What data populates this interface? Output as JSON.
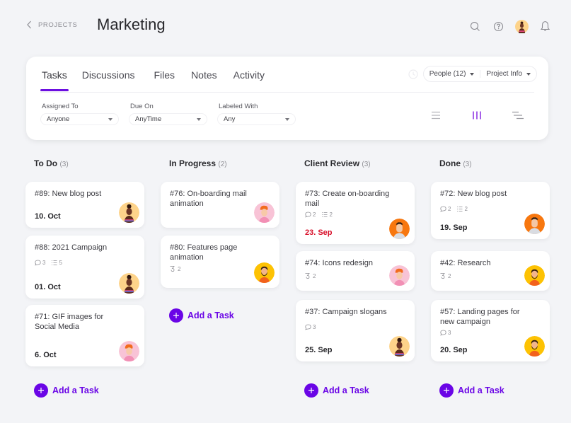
{
  "header": {
    "back_label": "PROJECTS",
    "title": "Marketing",
    "icons": [
      "search-icon",
      "help-icon",
      "user-avatar",
      "bell-icon"
    ]
  },
  "tabs": [
    {
      "label": "Tasks",
      "active": true
    },
    {
      "label": "Discussions",
      "active": false
    },
    {
      "label": "Files",
      "active": false
    },
    {
      "label": "Notes",
      "active": false
    },
    {
      "label": "Activity",
      "active": false
    }
  ],
  "toolbar": {
    "people_label": "People (12)",
    "project_info_label": "Project Info"
  },
  "filters": [
    {
      "label": "Assigned To",
      "value": "Anyone"
    },
    {
      "label": "Due On",
      "value": "AnyTime"
    },
    {
      "label": "Labeled With",
      "value": "Any"
    }
  ],
  "views": {
    "active": "board",
    "items": [
      "list-view",
      "board-view",
      "timeline-view"
    ]
  },
  "add_task_label": "Add a Task",
  "colors": {
    "accent": "#6a05e6",
    "overdue": "#d8102a",
    "background": "#f3f4f7"
  },
  "columns": [
    {
      "title": "To Do",
      "count": "(3)",
      "cards": [
        {
          "title": "#89: New blog post",
          "date": "10. Oct",
          "avatar": "woman-dark"
        },
        {
          "title": "#88: 2021 Campaign",
          "comments": "3",
          "subtasks": "5",
          "date": "01. Oct",
          "avatar": "woman-dark"
        },
        {
          "title": "#71: GIF images for Social Media",
          "date": "6. Oct",
          "avatar": "man-redhair-pink"
        }
      ]
    },
    {
      "title": "In Progress",
      "count": "(2)",
      "cards": [
        {
          "title": "#76: On-boarding mail animation",
          "avatar": "man-redhair-pink"
        },
        {
          "title": "#80: Features page animation",
          "attachments": "2",
          "avatar": "man-beard-yellow"
        }
      ]
    },
    {
      "title": "Client Review",
      "count": "(3)",
      "cards": [
        {
          "title": "#73: Create on-boarding mail",
          "comments": "2",
          "subtasks": "2",
          "date": "23. Sep",
          "overdue": true,
          "avatar": "man-orange"
        },
        {
          "title": "#74: Icons redesign",
          "attachments": "2",
          "avatar": "man-redhair-pink"
        },
        {
          "title": "#37: Campaign slogans",
          "comments": "3",
          "date": "25. Sep",
          "avatar": "woman-dark"
        }
      ]
    },
    {
      "title": "Done",
      "count": "(3)",
      "cards": [
        {
          "title": "#72: New blog post",
          "comments": "2",
          "subtasks": "2",
          "date": "19. Sep",
          "avatar": "man-orange"
        },
        {
          "title": "#42: Research",
          "attachments": "2",
          "avatar": "man-beard-yellow"
        },
        {
          "title": "#57: Landing pages for new campaign",
          "comments": "3",
          "date": "20. Sep",
          "avatar": "man-beard-yellow"
        }
      ]
    }
  ]
}
